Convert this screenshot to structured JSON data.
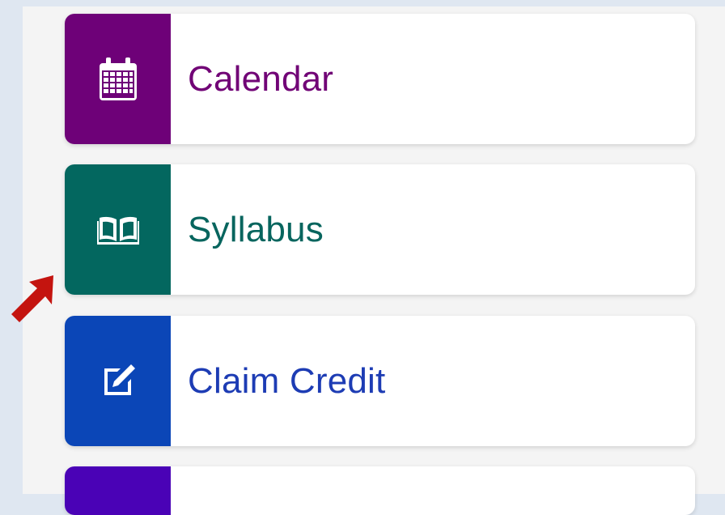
{
  "menu": {
    "items": [
      {
        "label": "Calendar",
        "icon": "calendar-icon",
        "accent": "#6e0178",
        "text_color": "#710476"
      },
      {
        "label": "Syllabus",
        "icon": "book-open-icon",
        "accent": "#03675f",
        "text_color": "#07655e"
      },
      {
        "label": "Claim Credit",
        "icon": "edit-square-icon",
        "accent": "#0b46b7",
        "text_color": "#1d3cb4"
      },
      {
        "label": "",
        "icon": "",
        "accent": "#4a02b6",
        "text_color": "#4a02b6"
      }
    ]
  },
  "annotation": {
    "arrow_color": "#c4140f",
    "icon": "pointer-arrow-icon"
  }
}
